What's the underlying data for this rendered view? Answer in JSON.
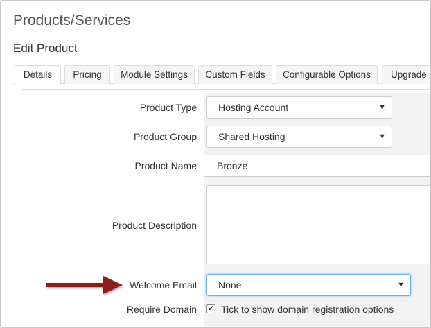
{
  "page_title": "Products/Services",
  "section_title": "Edit Product",
  "tabs": [
    {
      "label": "Details",
      "active": true
    },
    {
      "label": "Pricing",
      "active": false
    },
    {
      "label": "Module Settings",
      "active": false
    },
    {
      "label": "Custom Fields",
      "active": false
    },
    {
      "label": "Configurable Options",
      "active": false
    },
    {
      "label": "Upgrade",
      "active": false
    }
  ],
  "form": {
    "product_type": {
      "label": "Product Type",
      "value": "Hosting Account"
    },
    "product_group": {
      "label": "Product Group",
      "value": "Shared Hosting"
    },
    "product_name": {
      "label": "Product Name",
      "value": "Bronze"
    },
    "product_description": {
      "label": "Product Description",
      "value": ""
    },
    "welcome_email": {
      "label": "Welcome Email",
      "value": "None"
    },
    "require_domain": {
      "label": "Require Domain",
      "checkbox_label": "Tick to show domain registration options",
      "checked": true
    }
  },
  "icons": {
    "caret": "▼",
    "check": "✔"
  },
  "colors": {
    "arrow": "#8b1a1a",
    "focus_border": "#66afe9"
  }
}
